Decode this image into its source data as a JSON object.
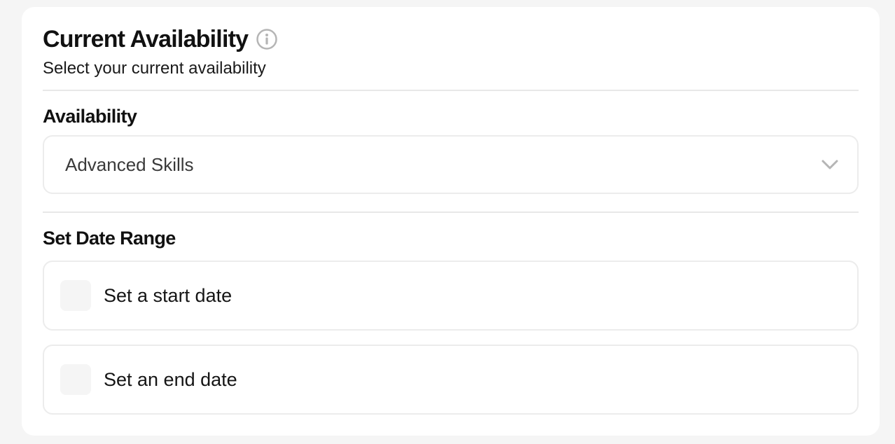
{
  "card": {
    "title": "Current Availability",
    "subtitle": "Select your current availability",
    "info_icon": "info-icon"
  },
  "availability": {
    "label": "Availability",
    "selected": "Advanced Skills",
    "icon": "chevron-down-icon"
  },
  "date_range": {
    "label": "Set Date Range",
    "options": [
      {
        "label": "Set a start date",
        "checked": false
      },
      {
        "label": "Set an end date",
        "checked": false
      }
    ]
  },
  "colors": {
    "background": "#f5f5f5",
    "card": "#ffffff",
    "border": "#ececec",
    "icon": "#b5b5b5"
  }
}
